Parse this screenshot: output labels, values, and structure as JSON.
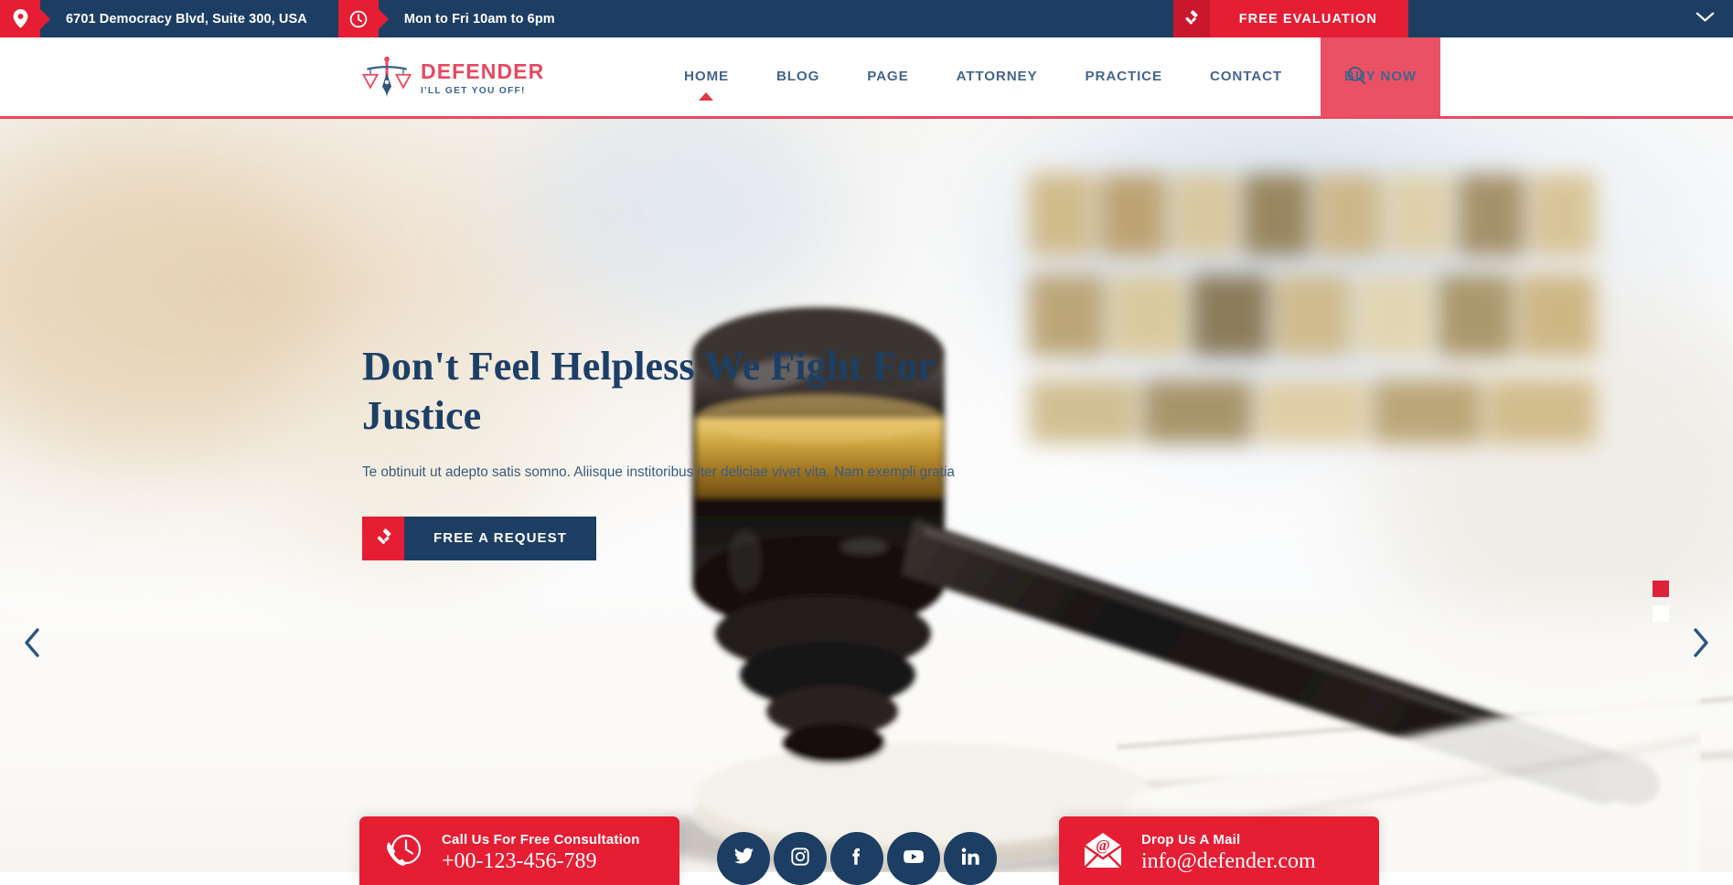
{
  "topbar": {
    "address": "6701 Democracy Blvd, Suite 300, USA",
    "hours": "Mon to Fri 10am to 6pm",
    "cta_label": "FREE EVALUATION",
    "location_icon": "map-pin-icon",
    "clock_icon": "clock-icon",
    "gavel_icon": "gavel-icon",
    "collapse_icon": "chevron-down-icon",
    "bg_color": "#1d3e63",
    "accent_color": "#e51e34"
  },
  "header": {
    "logo_name": "DEFENDER",
    "logo_tagline": "I'LL GET YOU OFF!",
    "logo_icon": "scales-of-justice-pen-icon",
    "search_icon": "search-icon",
    "nav": [
      {
        "label": "HOME",
        "active": true
      },
      {
        "label": "BLOG",
        "active": false
      },
      {
        "label": "PAGE",
        "active": false
      },
      {
        "label": "ATTORNEY",
        "active": false
      },
      {
        "label": "PRACTICE",
        "active": false
      },
      {
        "label": "CONTACT",
        "active": false
      }
    ],
    "buy_now_label": "BUY NOW",
    "nav_color": "#44658c",
    "buy_now_color": "#ea5165",
    "rule_color": "#e8495f"
  },
  "hero": {
    "title": "Don't Feel Helpless We Fight For Justice",
    "description": "Te obtinuit ut adepto satis somno. Aliisque institoribus iter deliciae vivet vita. Nam exempli gratia",
    "button_label": "FREE A REQUEST",
    "button_icon": "gavel-icon",
    "title_color": "#1c3f66",
    "prev_icon": "chevron-left-icon",
    "next_icon": "chevron-right-icon",
    "slide_indicators": [
      {
        "state": "active"
      },
      {
        "state": "idle"
      }
    ]
  },
  "contact": {
    "phone_title": "Call Us For Free Consultation",
    "phone_value": "+00-123-456-789",
    "phone_icon": "phone-clock-icon",
    "mail_title": "Drop Us A Mail",
    "mail_value": "info@defender.com",
    "mail_icon": "envelope-at-icon",
    "card_color": "#e51e34"
  },
  "socials": [
    {
      "name": "twitter",
      "icon": "twitter-icon"
    },
    {
      "name": "instagram",
      "icon": "instagram-icon"
    },
    {
      "name": "facebook",
      "icon": "facebook-icon"
    },
    {
      "name": "youtube",
      "icon": "youtube-icon"
    },
    {
      "name": "linkedin",
      "icon": "linkedin-icon"
    }
  ]
}
